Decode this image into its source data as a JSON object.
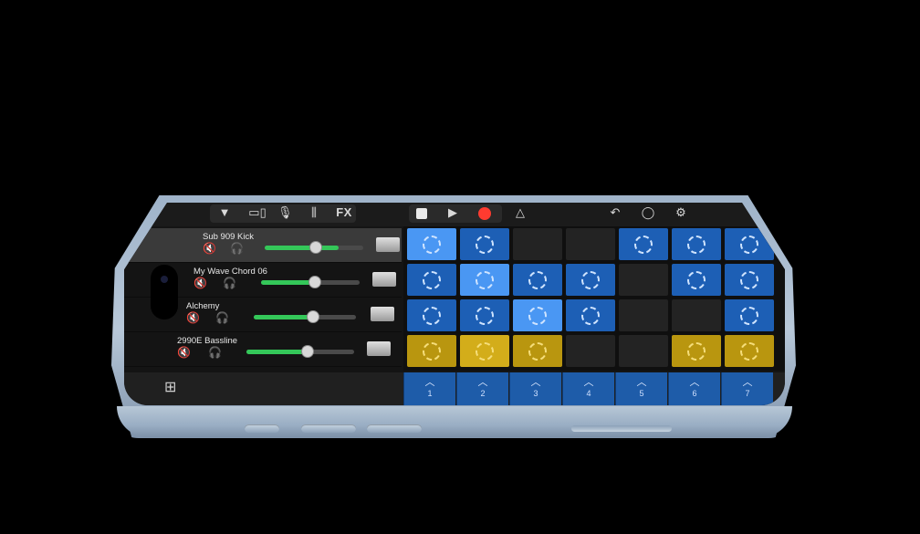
{
  "toolbar": {
    "icons": [
      "dropdown-icon",
      "view-toggle-icon",
      "mic-icon",
      "mixer-icon",
      "stop-icon",
      "play-icon",
      "record-icon",
      "metronome-icon",
      "undo-icon",
      "loop-icon",
      "settings-icon"
    ],
    "fx_label": "FX",
    "colors": {
      "record": "#ff3b30"
    }
  },
  "tracks": [
    {
      "name": "Sub 909 Kick",
      "volume": 0.75,
      "selected": true,
      "instrument_icon": "drum-machine-icon"
    },
    {
      "name": "My Wave Chord 06",
      "volume": 0.55,
      "selected": false,
      "instrument_icon": "synth-icon"
    },
    {
      "name": "Alchemy",
      "volume": 0.6,
      "selected": false,
      "instrument_icon": "keyboard-icon"
    },
    {
      "name": "2990E Bassline",
      "volume": 0.62,
      "selected": false,
      "instrument_icon": "sequencer-icon"
    }
  ],
  "grid": {
    "rows": [
      [
        "blue-playing",
        "blue",
        "empty",
        "empty",
        "blue",
        "blue",
        "blue"
      ],
      [
        "blue",
        "blue-playing",
        "blue",
        "blue",
        "empty",
        "blue",
        "blue"
      ],
      [
        "blue",
        "blue",
        "blue-playing",
        "blue",
        "empty",
        "empty",
        "blue"
      ],
      [
        "yellow",
        "yellow-playing",
        "yellow",
        "empty",
        "empty",
        "yellow",
        "yellow"
      ]
    ],
    "colors": {
      "blue": "#1d5fb5",
      "yellow": "#b9960f"
    }
  },
  "column_triggers": [
    "1",
    "2",
    "3",
    "4",
    "5",
    "6",
    "7"
  ]
}
